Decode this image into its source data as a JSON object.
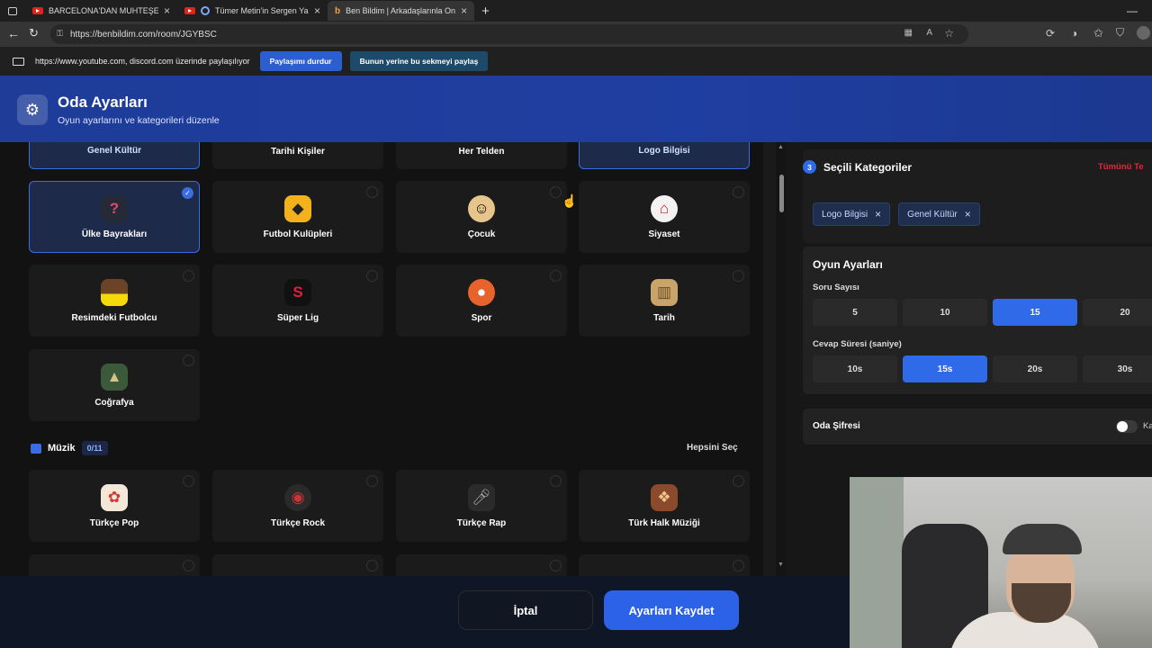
{
  "browser": {
    "tabs": [
      {
        "title": "BARCELONA'DAN MUHTEŞEM GÜ",
        "active": false
      },
      {
        "title": "Tümer Metin'in Sergen Yalçı",
        "active": false
      },
      {
        "title": "Ben Bildim | Arkadaşlarınla Online",
        "active": true
      }
    ],
    "url": "https://benbildim.com/room/JGYBSC",
    "share_text": "https://www.youtube.com, discord.com üzerinde paylaşılıyor",
    "stop_share": "Paylaşımı durdur",
    "share_this_tab": "Bunun yerine bu sekmeyi paylaş"
  },
  "header": {
    "title": "Oda Ayarları",
    "subtitle": "Oyun ayarlarını ve kategorileri düzenle"
  },
  "categories": {
    "top_row": [
      "Genel Kültür",
      "Tarihi Kişiler",
      "Her Telden",
      "Logo Bilgisi"
    ],
    "cards": [
      {
        "label": "Ülke Bayrakları",
        "icon": "question-mark-icon",
        "selected": true
      },
      {
        "label": "Futbol Kulüpleri",
        "icon": "wolf-badge-icon",
        "selected": false
      },
      {
        "label": "Çocuk",
        "icon": "child-icon",
        "selected": false
      },
      {
        "label": "Siyaset",
        "icon": "parliament-icon",
        "selected": false
      },
      {
        "label": "Resimdeki Futbolcu",
        "icon": "footballer-icon",
        "selected": false
      },
      {
        "label": "Süper Lig",
        "icon": "super-lig-logo-icon",
        "selected": false
      },
      {
        "label": "Spor",
        "icon": "sports-balls-icon",
        "selected": false
      },
      {
        "label": "Tarih",
        "icon": "colosseum-icon",
        "selected": false
      },
      {
        "label": "Coğrafya",
        "icon": "mountain-icon",
        "selected": false
      }
    ],
    "music_section": {
      "title": "Müzik",
      "count": "0/11",
      "select_all": "Hepsini Seç"
    },
    "music_cards": [
      {
        "label": "Türkçe Pop",
        "icon": "pop-icon"
      },
      {
        "label": "Türkçe Rock",
        "icon": "rock-icon"
      },
      {
        "label": "Türkçe Rap",
        "icon": "microphone-icon"
      },
      {
        "label": "Türk Halk Müziği",
        "icon": "folk-ornament-icon"
      }
    ]
  },
  "selected_panel": {
    "step": "3",
    "title": "Seçili Kategoriler",
    "clear_all": "Tümünü Te",
    "chips": [
      "Logo Bilgisi",
      "Genel Kültür"
    ]
  },
  "game_settings": {
    "title": "Oyun Ayarları",
    "question_count_label": "Soru Sayısı",
    "question_options": [
      "5",
      "10",
      "15",
      "20"
    ],
    "question_selected": "15",
    "answer_time_label": "Cevap Süresi (saniye)",
    "time_options": [
      "10s",
      "15s",
      "20s",
      "30s"
    ],
    "time_selected": "15s"
  },
  "room_password": {
    "label": "Oda Şifresi",
    "toggle_text": "Ka",
    "enabled": false
  },
  "footer": {
    "cancel": "İptal",
    "save": "Ayarları Kaydet"
  },
  "colors": {
    "accent": "#2f6ae8",
    "header": "#1f3ea1",
    "danger": "#e0293b"
  }
}
